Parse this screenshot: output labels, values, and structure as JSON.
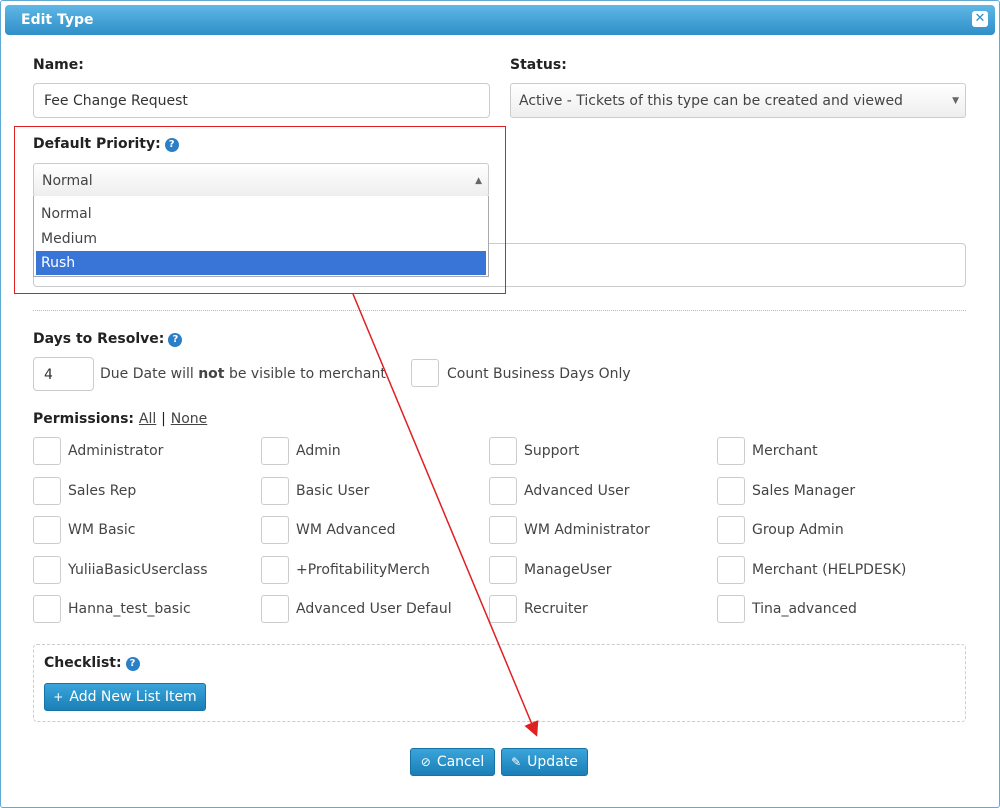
{
  "dialog": {
    "title": "Edit Type",
    "close_icon": "close-icon"
  },
  "name": {
    "label": "Name:",
    "value": "Fee Change Request"
  },
  "status": {
    "label": "Status:",
    "value": "Active - Tickets of this type can be created and viewed"
  },
  "priority": {
    "label": "Default Priority:",
    "selected": "Normal",
    "options": [
      "Normal",
      "Medium",
      "Rush"
    ],
    "highlighted": "Rush"
  },
  "days": {
    "label": "Days to Resolve:",
    "value": "4",
    "note_pre": "Due Date will",
    "note_bold": "not",
    "note_post": "be visible to merchant",
    "business_days_label": "Count Business Days Only"
  },
  "permissions": {
    "label": "Permissions:",
    "all_link": "All",
    "separator": "|",
    "none_link": "None",
    "items": [
      "Administrator",
      "Admin",
      "Support",
      "Merchant",
      "Sales Rep",
      "Basic User",
      "Advanced User",
      "Sales Manager",
      "WM Basic",
      "WM Advanced",
      "WM Administrator",
      "Group Admin",
      "YuliiaBasicUserclass",
      "+ProfitabilityMerch",
      "ManageUser",
      "Merchant (HELPDESK)",
      "Hanna_test_basic",
      "Advanced User Defaul",
      "Recruiter",
      "Tina_advanced"
    ]
  },
  "checklist": {
    "label": "Checklist:",
    "add_button": "Add New List Item"
  },
  "buttons": {
    "cancel": "Cancel",
    "update": "Update"
  },
  "annotation_color": "#e02020",
  "accent": "#2f8fc7"
}
